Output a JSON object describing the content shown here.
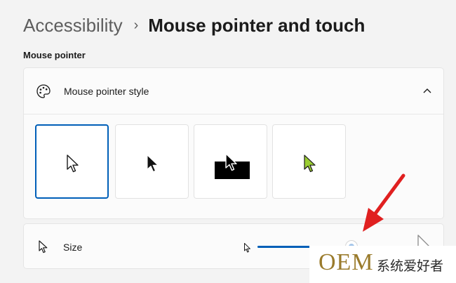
{
  "breadcrumb": {
    "parent": "Accessibility",
    "separator": "›",
    "title": "Mouse pointer and touch"
  },
  "section": {
    "label": "Mouse pointer"
  },
  "pointer_style": {
    "title": "Mouse pointer style",
    "expanded": true,
    "options": [
      {
        "id": "white",
        "icon": "white-pointer-icon",
        "selected": true
      },
      {
        "id": "black",
        "icon": "black-pointer-icon",
        "selected": false
      },
      {
        "id": "inverted",
        "icon": "inverted-pointer-icon",
        "selected": false
      },
      {
        "id": "custom",
        "icon": "custom-lime-pointer-icon",
        "selected": false,
        "color": "#9acd32"
      }
    ]
  },
  "size": {
    "label": "Size",
    "value_fraction": 0.62
  },
  "watermark": {
    "brand": "OEM",
    "text": "系统爱好者"
  },
  "colors": {
    "accent": "#005fb8",
    "annotation_arrow": "#e02020",
    "watermark_gold": "#9a7b2c"
  }
}
